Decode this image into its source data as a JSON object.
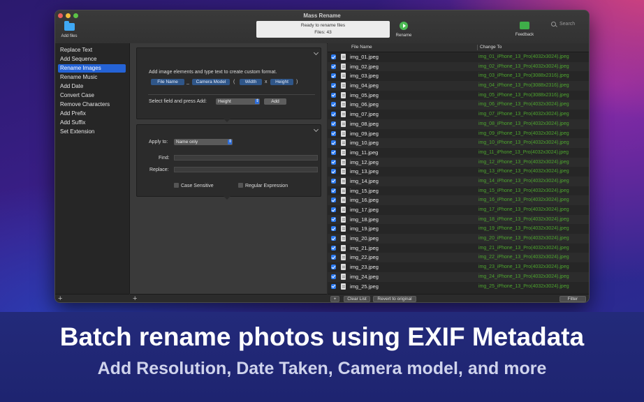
{
  "window": {
    "title": "Mass Rename"
  },
  "toolbar": {
    "add_files_label": "Add files",
    "status_line1": "Ready to rename files",
    "status_line2": "Files: 43",
    "rename_label": "Rename",
    "feedback_label": "Feedback",
    "search_placeholder": "Search"
  },
  "sidebar": {
    "items": [
      {
        "label": "Replace Text"
      },
      {
        "label": "Add Sequence"
      },
      {
        "label": "Rename Images"
      },
      {
        "label": "Rename Music"
      },
      {
        "label": "Add Date"
      },
      {
        "label": "Convert Case"
      },
      {
        "label": "Remove Characters"
      },
      {
        "label": "Add Prefix"
      },
      {
        "label": "Add Suffix"
      },
      {
        "label": "Set Extension"
      }
    ],
    "active": "Rename Images",
    "add_symbol": "+"
  },
  "image_panel": {
    "instruction": "Add image elements and type text to create custom format.",
    "tokens": {
      "t1": "File Name",
      "s1": "_",
      "t2": "Camera Model",
      "s2": "(",
      "t3": "Width",
      "s3": "x",
      "t4": "Height",
      "s4": ")"
    },
    "select_label": "Select field and press Add:",
    "select_value": "Height",
    "add_button": "Add"
  },
  "replace_panel": {
    "apply_label": "Apply to:",
    "apply_value": "Name only",
    "find_label": "Find:",
    "replace_label": "Replace:",
    "case_sensitive": "Case Sensitive",
    "regex": "Regular Expression"
  },
  "middle_add_symbol": "+",
  "file_list": {
    "col_name": "File Name",
    "col_change": "Change To",
    "rows": [
      {
        "name": "img_01.jpeg",
        "new": "img_01_iPhone_13_Pro(4032x3024).jpeg"
      },
      {
        "name": "img_02.jpeg",
        "new": "img_02_iPhone_13_Pro(4032x3024).jpeg"
      },
      {
        "name": "img_03.jpeg",
        "new": "img_03_iPhone_13_Pro(3088x2316).jpeg"
      },
      {
        "name": "img_04.jpeg",
        "new": "img_04_iPhone_13_Pro(3088x2316).jpeg"
      },
      {
        "name": "img_05.jpeg",
        "new": "img_05_iPhone_13_Pro(3088x2316).jpeg"
      },
      {
        "name": "img_06.jpeg",
        "new": "img_06_iPhone_13_Pro(4032x3024).jpeg"
      },
      {
        "name": "img_07.jpeg",
        "new": "img_07_iPhone_13_Pro(4032x3024).jpeg"
      },
      {
        "name": "img_08.jpeg",
        "new": "img_08_iPhone_13_Pro(4032x3024).jpeg"
      },
      {
        "name": "img_09.jpeg",
        "new": "img_09_iPhone_13_Pro(4032x3024).jpeg"
      },
      {
        "name": "img_10.jpeg",
        "new": "img_10_iPhone_13_Pro(4032x3024).jpeg"
      },
      {
        "name": "img_11.jpeg",
        "new": "img_11_iPhone_13_Pro(4032x3024).jpeg"
      },
      {
        "name": "img_12.jpeg",
        "new": "img_12_iPhone_13_Pro(4032x3024).jpeg"
      },
      {
        "name": "img_13.jpeg",
        "new": "img_13_iPhone_13_Pro(4032x3024).jpeg"
      },
      {
        "name": "img_14.jpeg",
        "new": "img_14_iPhone_13_Pro(4032x3024).jpeg"
      },
      {
        "name": "img_15.jpeg",
        "new": "img_15_iPhone_13_Pro(4032x3024).jpeg"
      },
      {
        "name": "img_16.jpeg",
        "new": "img_16_iPhone_13_Pro(4032x3024).jpeg"
      },
      {
        "name": "img_17.jpeg",
        "new": "img_17_iPhone_13_Pro(4032x3024).jpeg"
      },
      {
        "name": "img_18.jpeg",
        "new": "img_18_iPhone_13_Pro(4032x3024).jpeg"
      },
      {
        "name": "img_19.jpeg",
        "new": "img_19_iPhone_13_Pro(4032x3024).jpeg"
      },
      {
        "name": "img_20.jpeg",
        "new": "img_20_iPhone_13_Pro(4032x3024).jpeg"
      },
      {
        "name": "img_21.jpeg",
        "new": "img_21_iPhone_13_Pro(4032x3024).jpeg"
      },
      {
        "name": "img_22.jpeg",
        "new": "img_22_iPhone_13_Pro(4032x3024).jpeg"
      },
      {
        "name": "img_23.jpeg",
        "new": "img_23_iPhone_13_Pro(4032x3024).jpeg"
      },
      {
        "name": "img_24.jpeg",
        "new": "img_24_iPhone_13_Pro(4032x3024).jpeg"
      },
      {
        "name": "img_25.jpeg",
        "new": "img_25_iPhone_13_Pro(4032x3024).jpeg"
      }
    ],
    "add_symbol": "+",
    "clear_button": "Clear List",
    "revert_button": "Revert to original",
    "filter_button": "Filter"
  },
  "banner": {
    "title": "Batch rename photos using EXIF Metadata",
    "subtitle": "Add Resolution, Date Taken, Camera model, and more"
  },
  "colors": {
    "accent": "#2563d6",
    "new_name": "#4ea52f",
    "checkbox": "#2d7bf0",
    "token": "#2f5689"
  }
}
